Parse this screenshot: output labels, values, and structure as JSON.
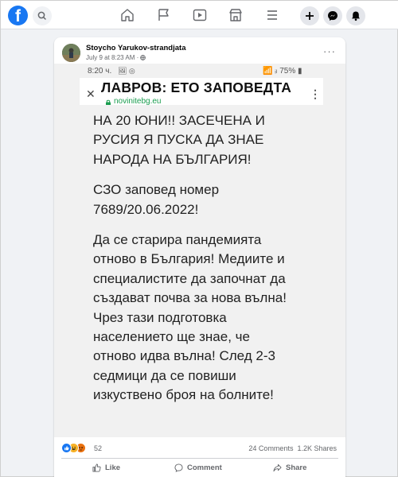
{
  "topbar": {
    "logo_letter": "f",
    "icons": [
      "search-icon",
      "home-icon",
      "flag-icon",
      "video-icon",
      "marketplace-icon",
      "menu-icon",
      "plus-icon",
      "messenger-icon",
      "notifications-icon"
    ]
  },
  "post": {
    "author": "Stoycho Yarukov-strandjata",
    "meta": "July 9 at 8:23 AM · ",
    "more": "···",
    "image": {
      "status_time": "8:20 ч.",
      "status_icons": "🖼 ◎",
      "status_right": "📶 ᵢₗ 75% ▮",
      "headline": "ЛАВРОВ: ЕТО ЗАПОВЕДТА",
      "url": "novinitebg.eu",
      "paragraphs": [
        [
          "НА 20 ЮНИ!! ЗАСЕЧЕНА И",
          "РУСИЯ Я ПУСКА ДА ЗНАЕ",
          "НАРОДА НА БЪЛГАРИЯ!"
        ],
        [
          "СЗО заповед номер",
          "7689/20.06.2022!"
        ],
        [
          "Да се старира пандемията",
          "отново в България! Медиите и",
          "специалистите да започнат да",
          "създават почва за нова вълна!",
          "Чрез тази подготовка",
          "населението ще знае, че",
          "отново идва вълна! След 2-3",
          "седмици да се повиши",
          "изкуствено броя на болните!"
        ]
      ]
    },
    "reactions": {
      "count": "52",
      "comments": "24 Comments",
      "shares": "1.2K Shares",
      "colors": {
        "like": "#1877f2",
        "haha": "#f7b125",
        "angry": "#e9710f"
      }
    },
    "actions": {
      "like": "Like",
      "comment": "Comment",
      "share": "Share"
    }
  }
}
